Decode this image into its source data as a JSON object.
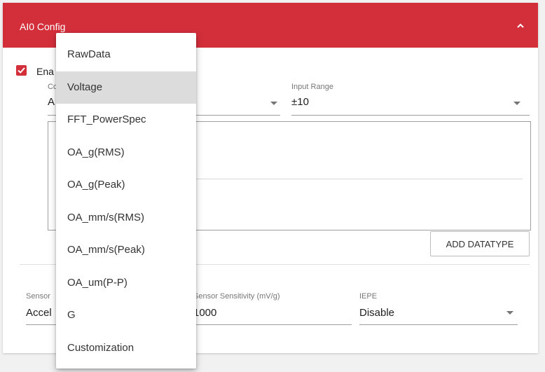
{
  "header": {
    "title": "AI0 Config"
  },
  "enable": {
    "label": "Ena",
    "checked": true
  },
  "channel_type": {
    "label": "Co",
    "value": "A"
  },
  "input_range": {
    "label": "Input Range",
    "value": "±10"
  },
  "add_datatype": {
    "label": "ADD DATATYPE"
  },
  "sensor_type": {
    "label": "Sensor",
    "value": "Accel"
  },
  "sensor_sensitivity": {
    "label": "Sensor Sensitivity (mV/g)",
    "value": "1000"
  },
  "iepe": {
    "label": "IEPE",
    "value": "Disable"
  },
  "dropdown": {
    "selected": "Voltage",
    "items": [
      "RawData",
      "Voltage",
      "FFT_PowerSpec",
      "OA_g(RMS)",
      "OA_g(Peak)",
      "OA_mm/s(RMS)",
      "OA_mm/s(Peak)",
      "OA_um(P-P)",
      "G",
      "Customization"
    ]
  },
  "colors": {
    "accent": "#d32f3b",
    "selected_bg": "#dcdcdc"
  }
}
